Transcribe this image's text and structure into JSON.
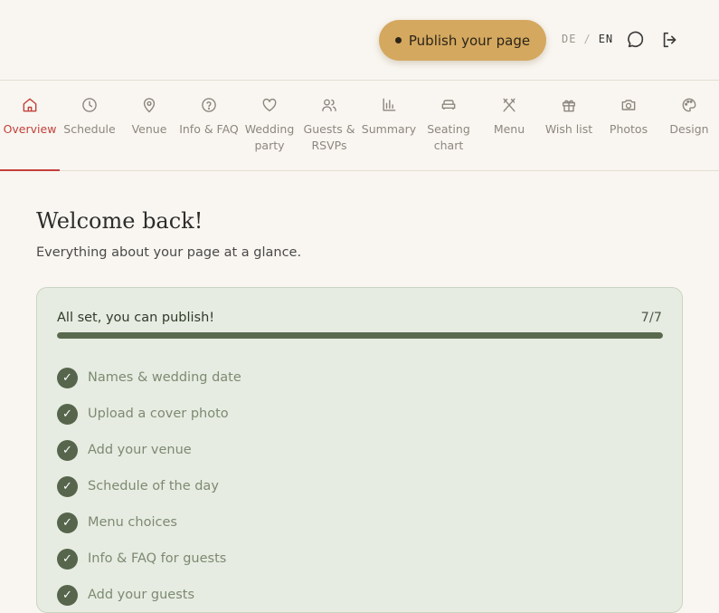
{
  "header": {
    "publish_label": "Publish your page",
    "lang_inactive": "DE",
    "lang_separator": "/",
    "lang_active": "EN",
    "chat_icon": "chat-bubble-icon",
    "logout_icon": "logout-icon"
  },
  "tabs": [
    {
      "label": "Overview",
      "icon": "home-icon",
      "active": true
    },
    {
      "label": "Schedule",
      "icon": "clock-icon"
    },
    {
      "label": "Venue",
      "icon": "map-pin-icon"
    },
    {
      "label": "Info & FAQ",
      "icon": "question-circle-icon"
    },
    {
      "label": "Wedding party",
      "icon": "heart-icon"
    },
    {
      "label": "Guests & RSVPs",
      "icon": "users-icon"
    },
    {
      "label": "Summary",
      "icon": "bar-chart-icon"
    },
    {
      "label": "Seating chart",
      "icon": "sofa-icon"
    },
    {
      "label": "Menu",
      "icon": "utensils-icon"
    },
    {
      "label": "Wish list",
      "icon": "gift-icon"
    },
    {
      "label": "Photos",
      "icon": "camera-icon"
    },
    {
      "label": "Design",
      "icon": "palette-icon"
    }
  ],
  "main": {
    "title": "Welcome back!",
    "subtitle": "Everything about your page at a glance."
  },
  "checklist": {
    "title": "All set, you can publish!",
    "count": "7/7",
    "progress": 1.0,
    "accent_color": "#56654c",
    "items": [
      {
        "label": "Names & wedding date",
        "done": true
      },
      {
        "label": "Upload a cover photo",
        "done": true
      },
      {
        "label": "Add your venue",
        "done": true
      },
      {
        "label": "Schedule of the day",
        "done": true
      },
      {
        "label": "Menu choices",
        "done": true
      },
      {
        "label": "Info & FAQ for guests",
        "done": true
      },
      {
        "label": "Add your guests",
        "done": true
      }
    ]
  }
}
